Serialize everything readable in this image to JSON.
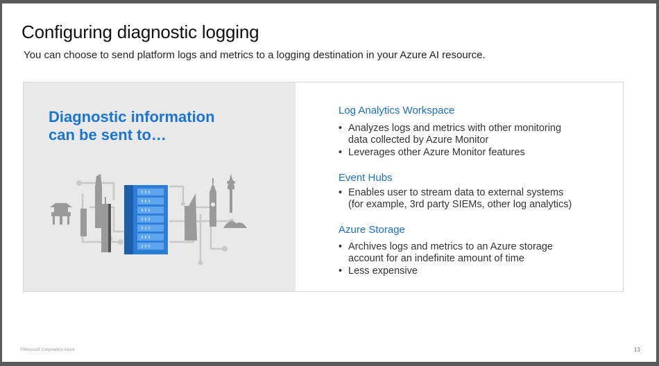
{
  "slide": {
    "title": "Configuring diagnostic logging",
    "subtitle": "You can choose to send platform logs and metrics to a logging destination in your Azure AI resource.",
    "left": {
      "heading_line1": "Diagnostic information",
      "heading_line2": "can be sent to…"
    },
    "sections": [
      {
        "title": "Log Analytics Workspace",
        "bullets": [
          [
            "Analyzes logs and metrics with other monitoring",
            "data collected by Azure Monitor"
          ],
          [
            "Leverages other Azure Monitor features"
          ]
        ]
      },
      {
        "title": "Event Hubs",
        "bullets": [
          [
            "Enables user to stream data to external systems",
            "(for example, 3rd party SIEMs, other log analytics)"
          ]
        ]
      },
      {
        "title": "Azure Storage",
        "bullets": [
          [
            "Archives logs and metrics to an Azure storage",
            "account for an indefinite amount of time"
          ],
          [
            "Less expensive"
          ]
        ]
      }
    ],
    "bullet_glyph": "•",
    "footer_left": "©Microsoft Corporation Azure",
    "page_number": "13"
  },
  "colors": {
    "accent": "#1a74d2",
    "server": "#2e7dd6",
    "panel_left": "#e9e9e9"
  },
  "icons": [
    "server-rack-icon",
    "city-skyline-icon",
    "circuit-lines-icon"
  ]
}
